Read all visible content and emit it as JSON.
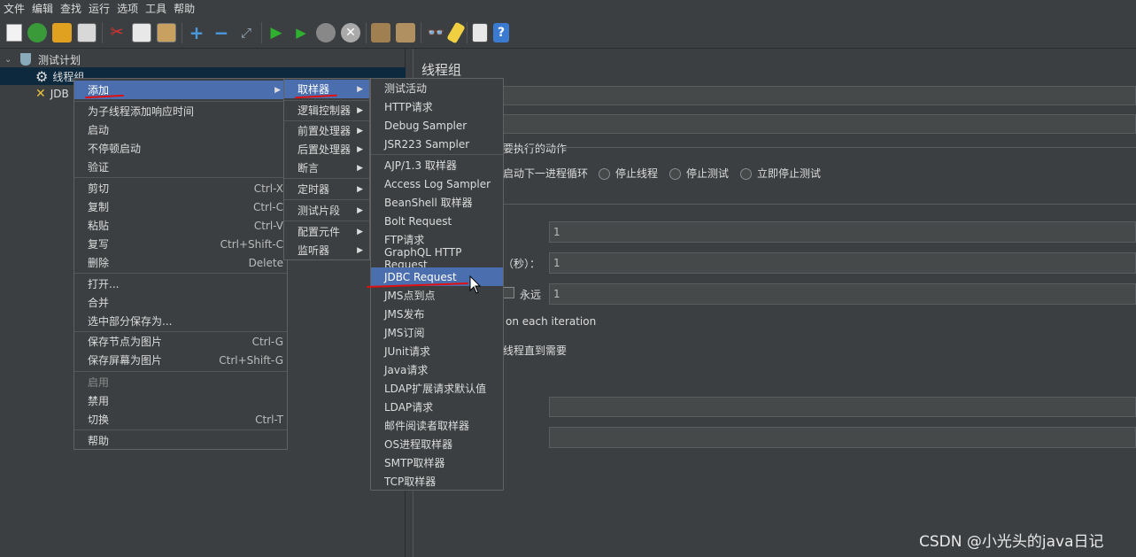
{
  "menubar": [
    "文件",
    "编辑",
    "查找",
    "运行",
    "选项",
    "工具",
    "帮助"
  ],
  "toolbar_icons": [
    "new-icon",
    "templates-icon",
    "open-icon",
    "save-icon",
    "cut-icon",
    "copy-icon",
    "paste-icon",
    "expand-icon",
    "collapse-icon",
    "toggle-icon",
    "start-icon",
    "start-no-timers-icon",
    "stop-icon",
    "shutdown-icon",
    "clear-icon",
    "clear-all-icon",
    "search-icon",
    "reset-search-icon",
    "function-helper-icon",
    "help-icon"
  ],
  "tree": {
    "test_plan": "测试计划",
    "thread_group": "线程组",
    "jdbc_node": "JDB"
  },
  "panel": {
    "title": "线程组",
    "action_heading": "要执行的动作",
    "radio_next_loop": "启动下一进程循环",
    "radio_stop_thread": "停止线程",
    "radio_stop_test": "停止测试",
    "radio_stop_now": "立即停止测试",
    "threads_value": "1",
    "rampup_label": "（秒）：",
    "rampup_value": "1",
    "forever_label": "永远",
    "loop_value": "1",
    "iteration_text": "on each iteration",
    "delay_text": "线程直到需要"
  },
  "context_menu": {
    "add": "添加",
    "add_response_time": "为子线程添加响应时间",
    "start": "启动",
    "start_no_pause": "不停顿启动",
    "validate": "验证",
    "cut": "剪切",
    "cut_sc": "Ctrl-X",
    "copy": "复制",
    "copy_sc": "Ctrl-C",
    "paste": "粘贴",
    "paste_sc": "Ctrl-V",
    "duplicate": "复写",
    "duplicate_sc": "Ctrl+Shift-C",
    "delete": "删除",
    "delete_sc": "Delete",
    "open": "打开...",
    "merge": "合并",
    "save_selection": "选中部分保存为...",
    "save_node_image": "保存节点为图片",
    "save_node_image_sc": "Ctrl-G",
    "save_screen_image": "保存屏幕为图片",
    "save_screen_image_sc": "Ctrl+Shift-G",
    "enable": "启用",
    "disable": "禁用",
    "toggle": "切换",
    "toggle_sc": "Ctrl-T",
    "help": "帮助"
  },
  "add_submenu": [
    "取样器",
    "逻辑控制器",
    "前置处理器",
    "后置处理器",
    "断言",
    "定时器",
    "测试片段",
    "配置元件",
    "监听器"
  ],
  "sampler_submenu": [
    "测试活动",
    "HTTP请求",
    "Debug Sampler",
    "JSR223 Sampler",
    "AJP/1.3 取样器",
    "Access Log Sampler",
    "BeanShell 取样器",
    "Bolt Request",
    "FTP请求",
    "GraphQL HTTP Request",
    "JDBC Request",
    "JMS点到点",
    "JMS发布",
    "JMS订阅",
    "JUnit请求",
    "Java请求",
    "LDAP扩展请求默认值",
    "LDAP请求",
    "邮件阅读者取样器",
    "OS进程取样器",
    "SMTP取样器",
    "TCP取样器"
  ],
  "watermark": "CSDN @小光头的java日记"
}
